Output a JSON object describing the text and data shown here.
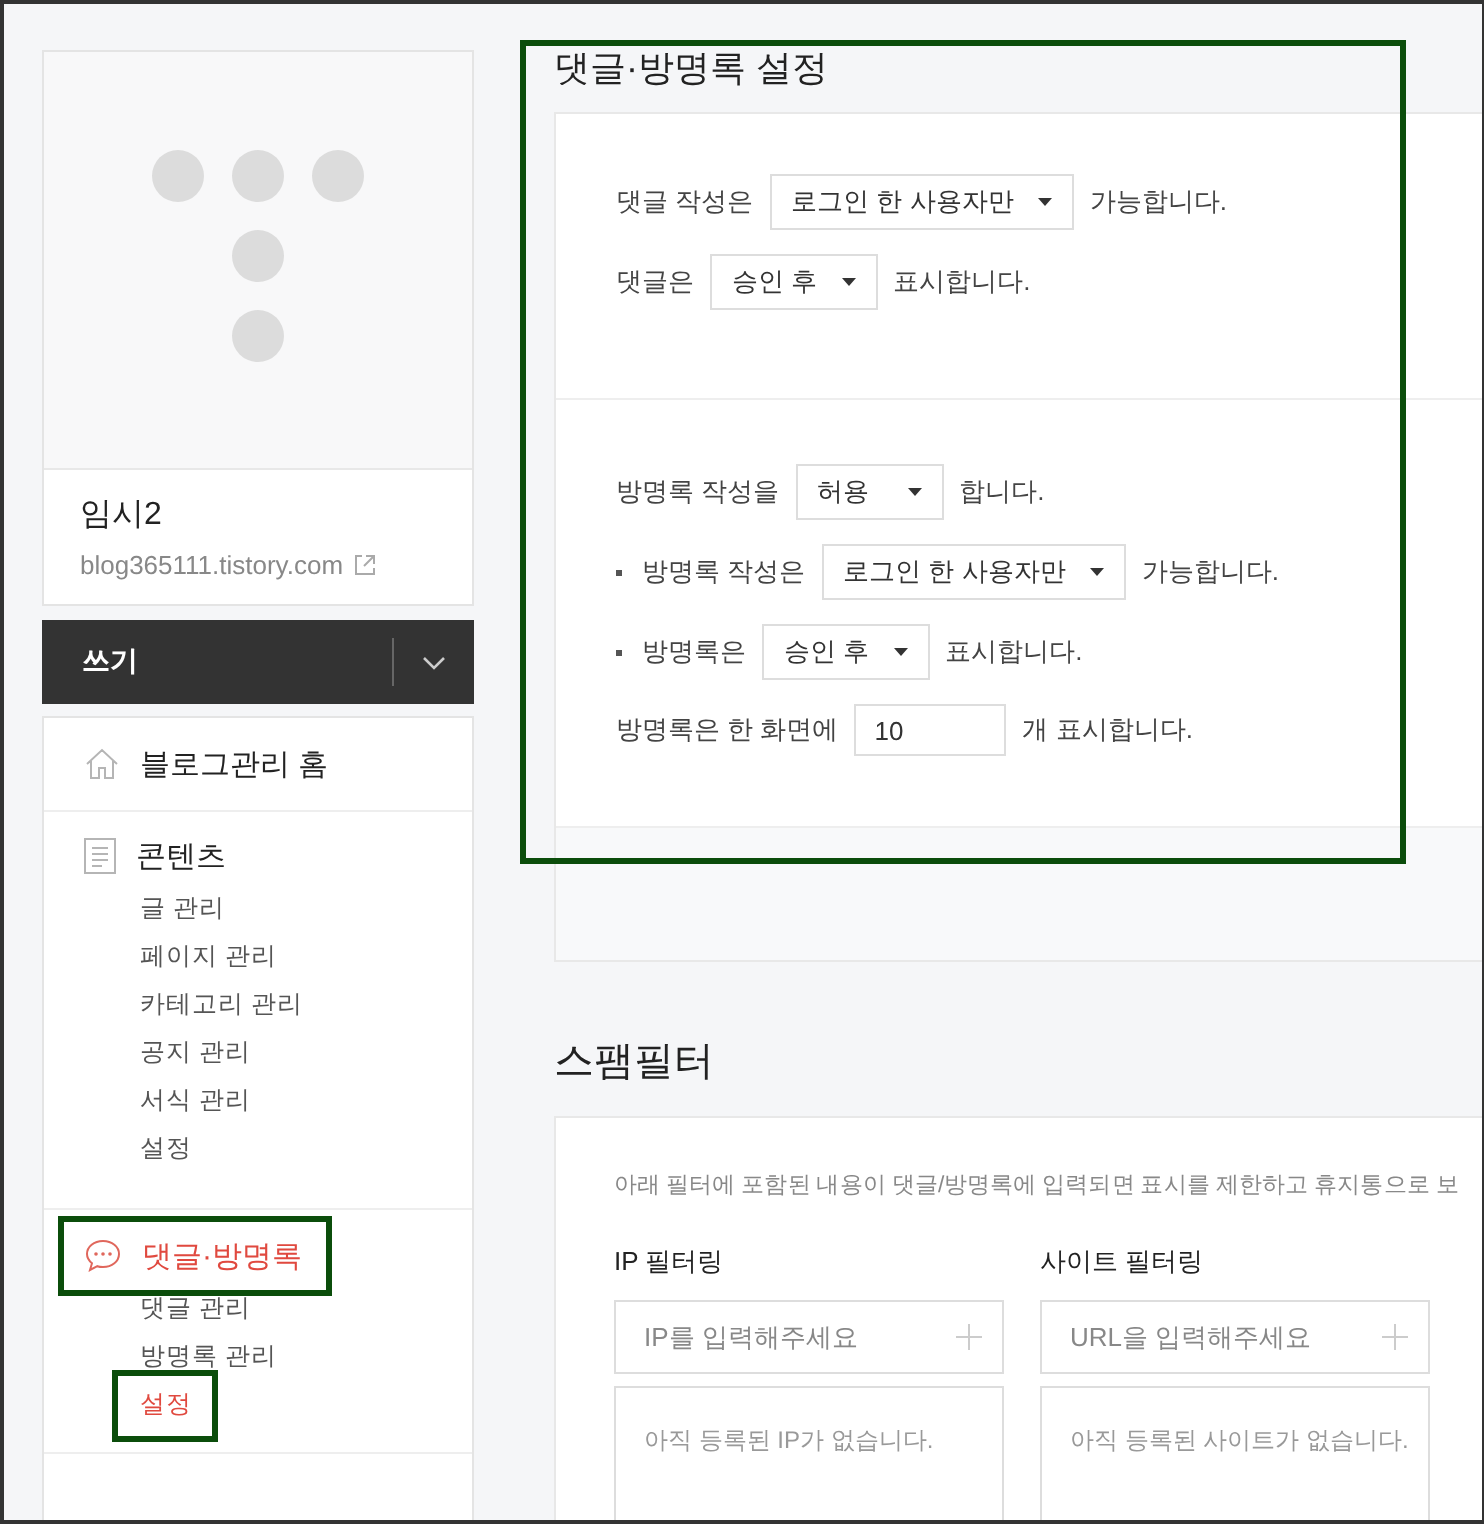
{
  "blog": {
    "name": "임시2",
    "url": "blog365111.tistory.com"
  },
  "write_button": {
    "label": "쓰기"
  },
  "nav": [
    {
      "label": "블로그관리 홈",
      "kind": "home",
      "selected": false,
      "highlighted": false
    },
    {
      "label": "콘텐츠",
      "kind": "document",
      "selected": false,
      "highlighted": false,
      "children": [
        {
          "label": "글 관리",
          "selected": false,
          "highlighted": false
        },
        {
          "label": "페이지 관리",
          "selected": false,
          "highlighted": false
        },
        {
          "label": "카테고리 관리",
          "selected": false,
          "highlighted": false
        },
        {
          "label": "공지 관리",
          "selected": false,
          "highlighted": false
        },
        {
          "label": "서식 관리",
          "selected": false,
          "highlighted": false
        },
        {
          "label": "설정",
          "selected": false,
          "highlighted": false
        }
      ]
    },
    {
      "label": "댓글·방명록",
      "kind": "comment",
      "selected": true,
      "highlighted": true,
      "children": [
        {
          "label": "댓글 관리",
          "selected": false,
          "highlighted": false
        },
        {
          "label": "방명록 관리",
          "selected": false,
          "highlighted": false
        },
        {
          "label": "설정",
          "selected": true,
          "highlighted": true
        }
      ]
    }
  ],
  "settings": {
    "title": "댓글·방명록 설정",
    "highlighted": true,
    "groups": [
      [
        {
          "kind": "select",
          "bullet": false,
          "prefix": "댓글 작성은",
          "value": "로그인 한 사용자만",
          "suffix": "가능합니다."
        },
        {
          "kind": "select",
          "bullet": false,
          "prefix": "댓글은",
          "value": "승인 후",
          "suffix": "표시합니다."
        }
      ],
      [
        {
          "kind": "select",
          "bullet": false,
          "prefix": "방명록 작성을",
          "value": "허용",
          "suffix": "합니다."
        },
        {
          "kind": "select",
          "bullet": true,
          "prefix": "방명록 작성은",
          "value": "로그인 한 사용자만",
          "suffix": "가능합니다."
        },
        {
          "kind": "select",
          "bullet": true,
          "prefix": "방명록은",
          "value": "승인 후",
          "suffix": "표시합니다."
        },
        {
          "kind": "input",
          "bullet": false,
          "prefix": "방명록은 한 화면에",
          "value": "10",
          "suffix": "개 표시합니다."
        }
      ]
    ]
  },
  "spam_filter": {
    "title": "스팸필터",
    "description": "아래 필터에 포함된 내용이 댓글/방명록에 입력되면 표시를 제한하고 휴지통으로 보",
    "filters": [
      {
        "title": "IP 필터링",
        "placeholder": "IP를 입력해주세요",
        "empty": "아직 등록된 IP가 없습니다."
      },
      {
        "title": "사이트 필터링",
        "placeholder": "URL을 입력해주세요",
        "empty": "아직 등록된 사이트가 없습니다."
      }
    ]
  }
}
